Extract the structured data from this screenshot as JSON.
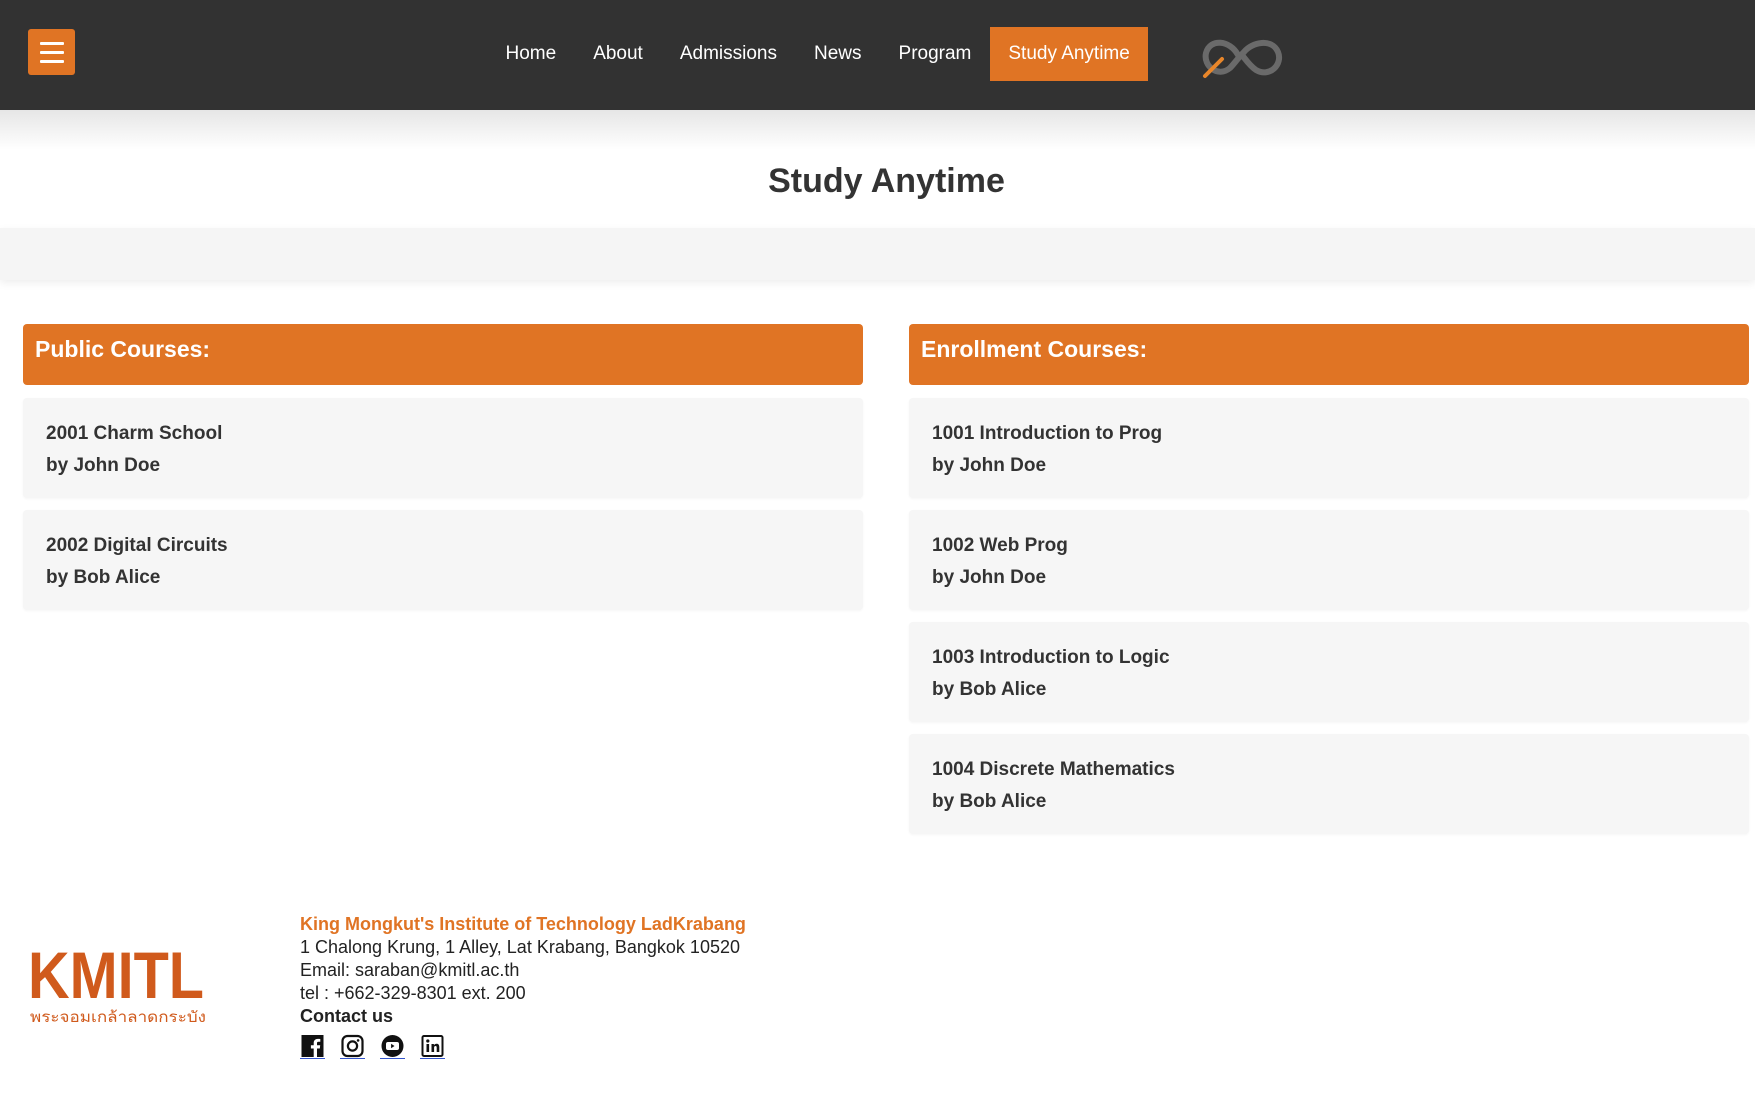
{
  "nav": {
    "items": [
      {
        "label": "Home"
      },
      {
        "label": "About"
      },
      {
        "label": "Admissions"
      },
      {
        "label": "News"
      },
      {
        "label": "Program"
      },
      {
        "label": "Study Anytime"
      }
    ],
    "active_index": 5
  },
  "page": {
    "title": "Study Anytime"
  },
  "public": {
    "heading": "Public Courses:",
    "courses": [
      {
        "title": "2001 Charm School",
        "instructor": "by John Doe"
      },
      {
        "title": "2002 Digital Circuits",
        "instructor": "by Bob Alice"
      }
    ]
  },
  "enrollment": {
    "heading": "Enrollment Courses:",
    "courses": [
      {
        "title": "1001 Introduction to Prog",
        "instructor": "by John Doe"
      },
      {
        "title": "1002 Web Prog",
        "instructor": "by John Doe"
      },
      {
        "title": "1003 Introduction to Logic",
        "instructor": "by Bob Alice"
      },
      {
        "title": "1004 Discrete Mathematics",
        "instructor": "by Bob Alice"
      }
    ]
  },
  "footer": {
    "logo_text": "KMITL",
    "logo_subtext": "พระจอมเกล้าลาดกระบัง",
    "org_name": "King Mongkut's Institute of Technology LadKrabang",
    "address": "1 Chalong Krung, 1 Alley, Lat Krabang, Bangkok 10520",
    "email": "Email: saraban@kmitl.ac.th",
    "tel": "tel : +662-329-8301 ext. 200",
    "contact_label": "Contact us",
    "socials": [
      "facebook-icon",
      "instagram-icon",
      "youtube-icon",
      "linkedin-icon"
    ]
  },
  "colors": {
    "accent": "#e07424",
    "header_bg": "#323232",
    "card_bg": "#f6f6f6"
  }
}
